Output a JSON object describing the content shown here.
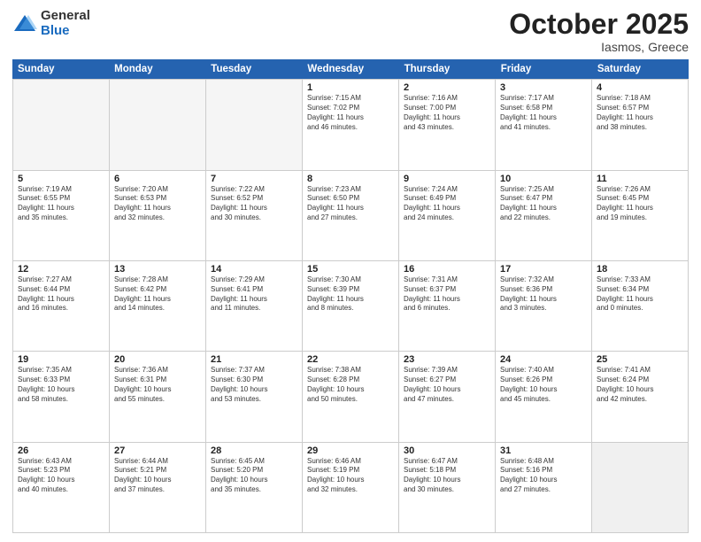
{
  "logo": {
    "general": "General",
    "blue": "Blue"
  },
  "title": {
    "month": "October 2025",
    "location": "Iasmos, Greece"
  },
  "headers": [
    "Sunday",
    "Monday",
    "Tuesday",
    "Wednesday",
    "Thursday",
    "Friday",
    "Saturday"
  ],
  "weeks": [
    [
      {
        "day": "",
        "info": ""
      },
      {
        "day": "",
        "info": ""
      },
      {
        "day": "",
        "info": ""
      },
      {
        "day": "1",
        "info": "Sunrise: 7:15 AM\nSunset: 7:02 PM\nDaylight: 11 hours\nand 46 minutes."
      },
      {
        "day": "2",
        "info": "Sunrise: 7:16 AM\nSunset: 7:00 PM\nDaylight: 11 hours\nand 43 minutes."
      },
      {
        "day": "3",
        "info": "Sunrise: 7:17 AM\nSunset: 6:58 PM\nDaylight: 11 hours\nand 41 minutes."
      },
      {
        "day": "4",
        "info": "Sunrise: 7:18 AM\nSunset: 6:57 PM\nDaylight: 11 hours\nand 38 minutes."
      }
    ],
    [
      {
        "day": "5",
        "info": "Sunrise: 7:19 AM\nSunset: 6:55 PM\nDaylight: 11 hours\nand 35 minutes."
      },
      {
        "day": "6",
        "info": "Sunrise: 7:20 AM\nSunset: 6:53 PM\nDaylight: 11 hours\nand 32 minutes."
      },
      {
        "day": "7",
        "info": "Sunrise: 7:22 AM\nSunset: 6:52 PM\nDaylight: 11 hours\nand 30 minutes."
      },
      {
        "day": "8",
        "info": "Sunrise: 7:23 AM\nSunset: 6:50 PM\nDaylight: 11 hours\nand 27 minutes."
      },
      {
        "day": "9",
        "info": "Sunrise: 7:24 AM\nSunset: 6:49 PM\nDaylight: 11 hours\nand 24 minutes."
      },
      {
        "day": "10",
        "info": "Sunrise: 7:25 AM\nSunset: 6:47 PM\nDaylight: 11 hours\nand 22 minutes."
      },
      {
        "day": "11",
        "info": "Sunrise: 7:26 AM\nSunset: 6:45 PM\nDaylight: 11 hours\nand 19 minutes."
      }
    ],
    [
      {
        "day": "12",
        "info": "Sunrise: 7:27 AM\nSunset: 6:44 PM\nDaylight: 11 hours\nand 16 minutes."
      },
      {
        "day": "13",
        "info": "Sunrise: 7:28 AM\nSunset: 6:42 PM\nDaylight: 11 hours\nand 14 minutes."
      },
      {
        "day": "14",
        "info": "Sunrise: 7:29 AM\nSunset: 6:41 PM\nDaylight: 11 hours\nand 11 minutes."
      },
      {
        "day": "15",
        "info": "Sunrise: 7:30 AM\nSunset: 6:39 PM\nDaylight: 11 hours\nand 8 minutes."
      },
      {
        "day": "16",
        "info": "Sunrise: 7:31 AM\nSunset: 6:37 PM\nDaylight: 11 hours\nand 6 minutes."
      },
      {
        "day": "17",
        "info": "Sunrise: 7:32 AM\nSunset: 6:36 PM\nDaylight: 11 hours\nand 3 minutes."
      },
      {
        "day": "18",
        "info": "Sunrise: 7:33 AM\nSunset: 6:34 PM\nDaylight: 11 hours\nand 0 minutes."
      }
    ],
    [
      {
        "day": "19",
        "info": "Sunrise: 7:35 AM\nSunset: 6:33 PM\nDaylight: 10 hours\nand 58 minutes."
      },
      {
        "day": "20",
        "info": "Sunrise: 7:36 AM\nSunset: 6:31 PM\nDaylight: 10 hours\nand 55 minutes."
      },
      {
        "day": "21",
        "info": "Sunrise: 7:37 AM\nSunset: 6:30 PM\nDaylight: 10 hours\nand 53 minutes."
      },
      {
        "day": "22",
        "info": "Sunrise: 7:38 AM\nSunset: 6:28 PM\nDaylight: 10 hours\nand 50 minutes."
      },
      {
        "day": "23",
        "info": "Sunrise: 7:39 AM\nSunset: 6:27 PM\nDaylight: 10 hours\nand 47 minutes."
      },
      {
        "day": "24",
        "info": "Sunrise: 7:40 AM\nSunset: 6:26 PM\nDaylight: 10 hours\nand 45 minutes."
      },
      {
        "day": "25",
        "info": "Sunrise: 7:41 AM\nSunset: 6:24 PM\nDaylight: 10 hours\nand 42 minutes."
      }
    ],
    [
      {
        "day": "26",
        "info": "Sunrise: 6:43 AM\nSunset: 5:23 PM\nDaylight: 10 hours\nand 40 minutes."
      },
      {
        "day": "27",
        "info": "Sunrise: 6:44 AM\nSunset: 5:21 PM\nDaylight: 10 hours\nand 37 minutes."
      },
      {
        "day": "28",
        "info": "Sunrise: 6:45 AM\nSunset: 5:20 PM\nDaylight: 10 hours\nand 35 minutes."
      },
      {
        "day": "29",
        "info": "Sunrise: 6:46 AM\nSunset: 5:19 PM\nDaylight: 10 hours\nand 32 minutes."
      },
      {
        "day": "30",
        "info": "Sunrise: 6:47 AM\nSunset: 5:18 PM\nDaylight: 10 hours\nand 30 minutes."
      },
      {
        "day": "31",
        "info": "Sunrise: 6:48 AM\nSunset: 5:16 PM\nDaylight: 10 hours\nand 27 minutes."
      },
      {
        "day": "",
        "info": ""
      }
    ]
  ]
}
